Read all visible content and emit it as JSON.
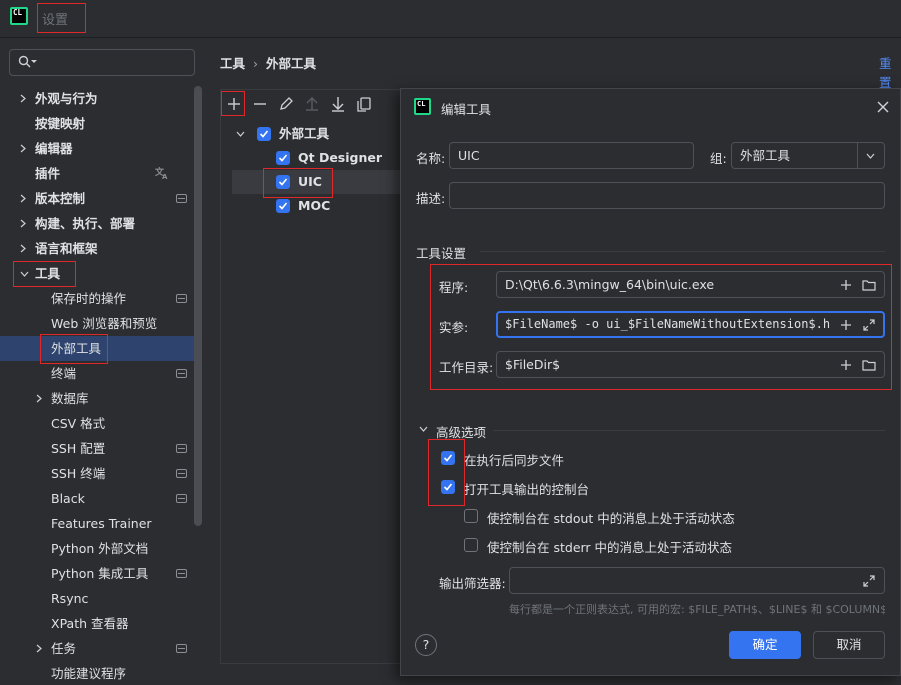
{
  "window": {
    "logo_text": "CL",
    "title": "设置"
  },
  "sidebar": {
    "search_placeholder": "",
    "items": [
      {
        "label": "外观与行为"
      },
      {
        "label": "按键映射"
      },
      {
        "label": "编辑器"
      },
      {
        "label": "插件"
      },
      {
        "label": "版本控制"
      },
      {
        "label": "构建、执行、部署"
      },
      {
        "label": "语言和框架"
      },
      {
        "label": "工具"
      },
      {
        "label": "保存时的操作"
      },
      {
        "label": "Web 浏览器和预览"
      },
      {
        "label": "外部工具"
      },
      {
        "label": "终端"
      },
      {
        "label": "数据库"
      },
      {
        "label": "CSV 格式"
      },
      {
        "label": "SSH 配置"
      },
      {
        "label": "SSH 终端"
      },
      {
        "label": "Black"
      },
      {
        "label": "Features Trainer"
      },
      {
        "label": "Python 外部文档"
      },
      {
        "label": "Python 集成工具"
      },
      {
        "label": "Rsync"
      },
      {
        "label": "XPath 查看器"
      },
      {
        "label": "任务"
      },
      {
        "label": "功能建议程序"
      }
    ]
  },
  "breadcrumb": {
    "parent": "工具",
    "current": "外部工具"
  },
  "reset_link": "重置",
  "tools_tree": {
    "group": "外部工具",
    "items": [
      "Qt Designer",
      "UIC",
      "MOC"
    ]
  },
  "dialog": {
    "logo_text": "CL",
    "title": "编辑工具",
    "name_label": "名称:",
    "name_value": "UIC",
    "group_label": "组:",
    "group_value": "外部工具",
    "desc_label": "描述:",
    "desc_value": "",
    "tool_settings_title": "工具设置",
    "program_label": "程序:",
    "program_value": "D:\\Qt\\6.6.3\\mingw_64\\bin\\uic.exe",
    "args_label": "实参:",
    "args_value": "$FileName$ -o ui_$FileNameWithoutExtension$.h",
    "workdir_label": "工作目录:",
    "workdir_value": "$FileDir$",
    "advanced_title": "高级选项",
    "opt_sync": "在执行后同步文件",
    "opt_console": "打开工具输出的控制台",
    "opt_stdout": "使控制台在 stdout 中的消息上处于活动状态",
    "opt_stderr": "使控制台在 stderr 中的消息上处于活动状态",
    "filter_label": "输出筛选器:",
    "filter_value": "",
    "filter_hint": "每行都是一个正则表达式, 可用的宏: $FILE_PATH$、$LINE$ 和 $COLUMN$",
    "help_label": "?",
    "ok_label": "确定",
    "cancel_label": "取消"
  },
  "colors": {
    "accent": "#3574f0",
    "highlight": "#e0282a",
    "selection": "#2e436e"
  }
}
